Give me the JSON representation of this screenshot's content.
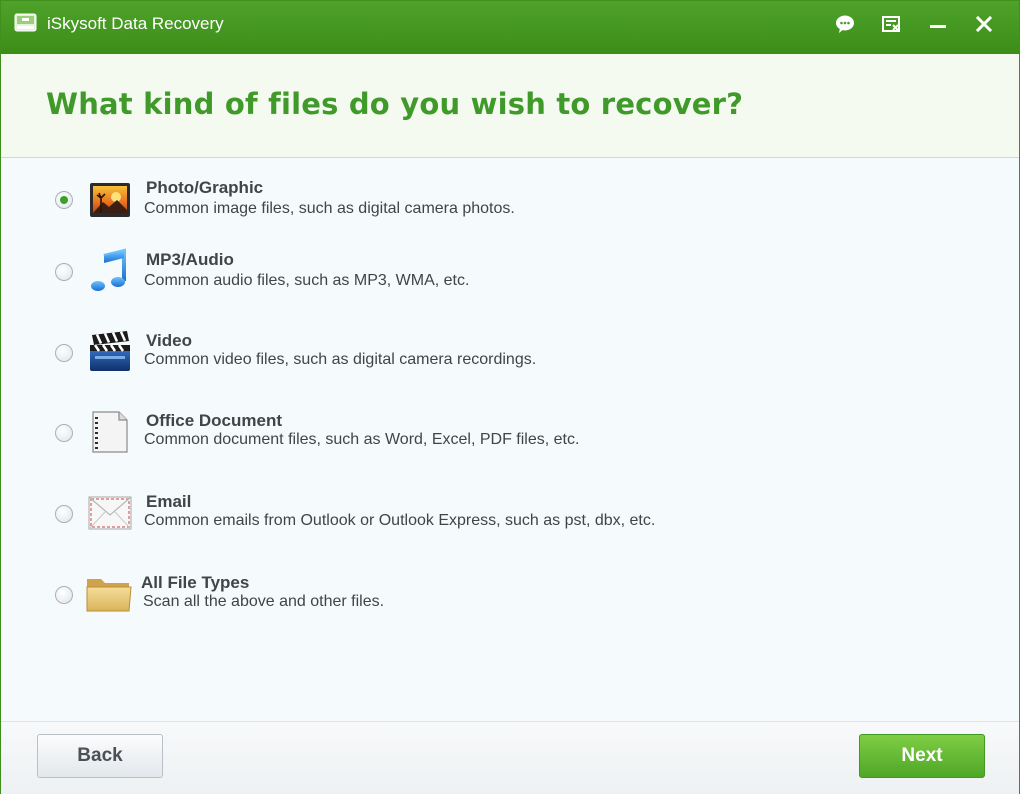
{
  "window": {
    "title": "iSkysoft Data Recovery",
    "icons": [
      "drive-icon",
      "feedback-icon",
      "register-icon",
      "minimize-icon",
      "close-icon"
    ]
  },
  "header": {
    "title": "What kind of files do you wish to recover?"
  },
  "options": [
    {
      "label": "Photo/Graphic",
      "description": "Common image files, such as digital camera photos.",
      "selected": true,
      "icon": "photo-icon"
    },
    {
      "label": "MP3/Audio",
      "description": "Common audio files, such as MP3, WMA, etc.",
      "selected": false,
      "icon": "music-note-icon"
    },
    {
      "label": "Video",
      "description": "Common video files, such as digital camera recordings.",
      "selected": false,
      "icon": "clapperboard-icon"
    },
    {
      "label": "Office Document",
      "description": "Common document files, such as Word, Excel, PDF files, etc.",
      "selected": false,
      "icon": "document-icon"
    },
    {
      "label": "Email",
      "description": "Common emails from Outlook or Outlook Express, such as pst, dbx, etc.",
      "selected": false,
      "icon": "envelope-icon"
    },
    {
      "label": "All File Types",
      "description": "Scan all the above and other files.",
      "selected": false,
      "icon": "folder-icon"
    }
  ],
  "footer": {
    "back_label": "Back",
    "next_label": "Next"
  },
  "colors": {
    "brand_green": "#3f9a2a",
    "titlebar_green": "#4ea22a",
    "next_button": "#5bb52f"
  }
}
